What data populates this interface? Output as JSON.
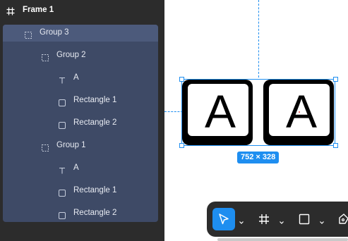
{
  "layers_panel": {
    "frame": {
      "label": "Frame 1",
      "icon": "frame-hash-icon"
    },
    "layers": [
      {
        "label": "Group 3",
        "icon": "group-dashed-icon",
        "selected_head": true
      },
      {
        "label": "Group 2",
        "icon": "group-dashed-icon"
      },
      {
        "label": "A",
        "icon": "text-icon"
      },
      {
        "label": "Rectangle 1",
        "icon": "rectangle-icon"
      },
      {
        "label": "Rectangle 2",
        "icon": "rectangle-icon"
      },
      {
        "label": "Group 1",
        "icon": "group-dashed-icon"
      },
      {
        "label": "A",
        "icon": "text-icon"
      },
      {
        "label": "Rectangle 1",
        "icon": "rectangle-icon"
      },
      {
        "label": "Rectangle 2",
        "icon": "rectangle-icon"
      }
    ],
    "colors": {
      "panel_bg": "#2c2c2c",
      "selection_bg": "#3e4a66",
      "selection_head_bg": "#4c5a7b"
    }
  },
  "canvas": {
    "keys": [
      {
        "letter": "A"
      },
      {
        "letter": "A"
      }
    ],
    "selection_size": "752 × 328",
    "colors": {
      "accent": "#1e8ef0"
    }
  },
  "toolbar": {
    "tools": [
      {
        "name": "move-tool",
        "icon": "cursor-arrow-icon",
        "active": true
      },
      {
        "name": "frame-tool",
        "icon": "frame-hash-icon",
        "active": false
      },
      {
        "name": "shape-tool",
        "icon": "rectangle-icon",
        "active": false
      },
      {
        "name": "pen-tool",
        "icon": "pen-nib-icon",
        "active": false
      }
    ]
  }
}
